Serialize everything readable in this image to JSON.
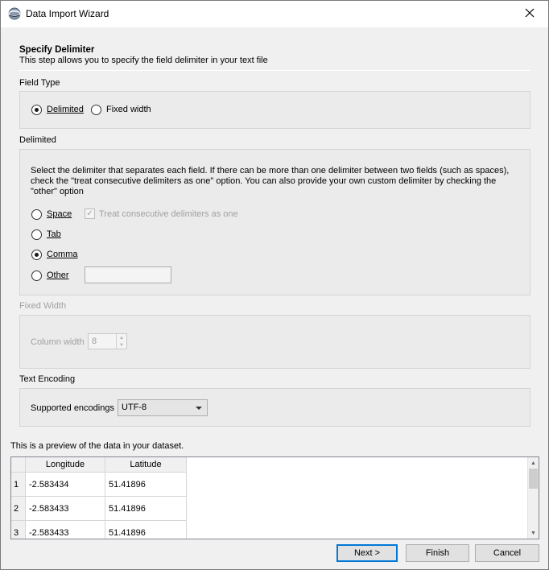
{
  "window": {
    "title": "Data Import Wizard"
  },
  "header": {
    "title": "Specify Delimiter",
    "description": "This step allows you to specify the field delimiter in your text file"
  },
  "field_type": {
    "label": "Field Type",
    "options": [
      {
        "label": "Delimited",
        "checked": true
      },
      {
        "label": "Fixed width",
        "checked": false
      }
    ]
  },
  "delimited": {
    "label": "Delimited",
    "instructions_1": "Select the delimiter that separates each field.  If there can be more than one delimiter between two fields (such as spaces),",
    "instructions_2": "check the \"treat consecutive delimiters as one\" option.  You can also provide your own custom delimiter by checking the",
    "instructions_3": "\"other\" option",
    "space_label": "Space",
    "consecutive_label": "Treat consecutive delimiters as one",
    "consecutive_checked": true,
    "tab_label": "Tab",
    "comma_label": "Comma",
    "other_label": "Other",
    "other_value": "",
    "selected": "Comma"
  },
  "fixed_width": {
    "label": "Fixed Width",
    "column_width_label": "Column width",
    "column_width_value": "8"
  },
  "text_encoding": {
    "label": "Text Encoding",
    "supported_label": "Supported encodings",
    "selected": "UTF-8"
  },
  "preview": {
    "label": "This is a preview of the data in your dataset.",
    "columns": [
      "Longitude",
      "Latitude"
    ],
    "rows": [
      {
        "n": "1",
        "cells": [
          "-2.583434",
          "51.41896"
        ]
      },
      {
        "n": "2",
        "cells": [
          "-2.583433",
          "51.41896"
        ]
      },
      {
        "n": "3",
        "cells": [
          "-2.583433",
          "51.41896"
        ]
      }
    ]
  },
  "buttons": {
    "next": "Next >",
    "finish": "Finish",
    "cancel": "Cancel"
  }
}
